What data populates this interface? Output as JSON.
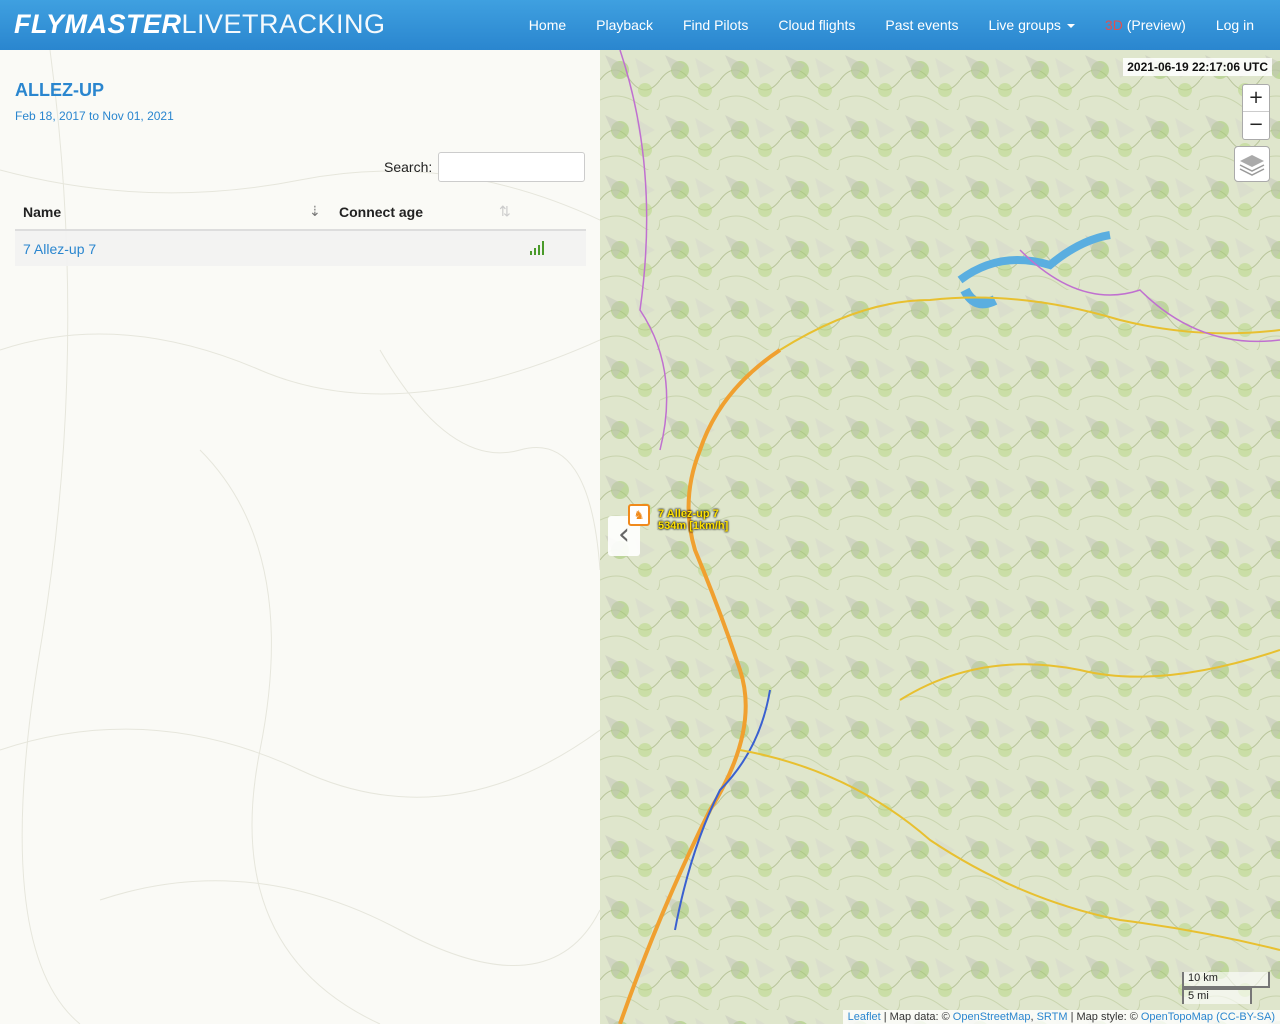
{
  "brand": {
    "bold": "FLYMASTER",
    "light": "LIVETRACKING"
  },
  "nav": {
    "home": "Home",
    "playback": "Playback",
    "find_pilots": "Find Pilots",
    "cloud_flights": "Cloud flights",
    "past_events": "Past events",
    "live_groups": "Live groups",
    "threed_prefix": "3D",
    "threed_suffix": " (Preview)",
    "login": "Log in"
  },
  "event": {
    "title": "ALLEZ-UP",
    "dates": "Feb 18, 2017 to Nov 01, 2021"
  },
  "search": {
    "label": "Search:",
    "value": "",
    "placeholder": ""
  },
  "table": {
    "columns": [
      "Name",
      "Connect age"
    ],
    "rows": [
      {
        "name": "7 Allez-up 7",
        "signal": "signal-bars-icon"
      }
    ]
  },
  "map": {
    "timestamp": "2021-06-19 22:17:06 UTC",
    "zoom_in": "+",
    "zoom_out": "−",
    "pilot_label_line1": "7 Allez-up 7",
    "pilot_label_line2": "534m [1km/h]",
    "scale_km": "10 km",
    "scale_mi": "5 mi",
    "attribution": {
      "leaflet": "Leaflet",
      "sep1": " | Map data: © ",
      "osm": "OpenStreetMap",
      "comma": ", ",
      "srtm": "SRTM",
      "sep2": " | Map style: © ",
      "otm": "OpenTopoMap",
      "license": "(CC-BY-SA)"
    }
  },
  "colors": {
    "brand_blue": "#2a86cf",
    "marker_orange": "#f08a1c",
    "label_yellow": "#ffe000"
  }
}
